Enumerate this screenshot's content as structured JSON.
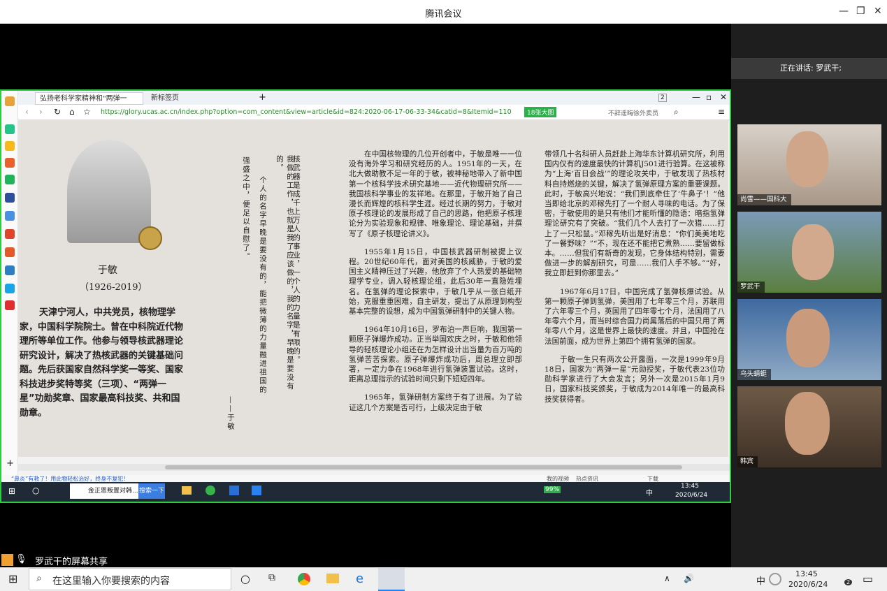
{
  "window": {
    "title": "腾讯会议"
  },
  "browser": {
    "tabs": [
      "弘扬老科学家精神和\"两弹一星\"精",
      "新标签页"
    ],
    "url": "https://glory.ucas.ac.cn/index.php?option=com_content&view=article&id=824:2020-06-17-06-33-34&catid=8&Itemid=110",
    "btn_bigimg": "18张大图",
    "search_placeholder": "不辞遥晦徐外卖员",
    "tab_count": "2",
    "status_left": "“鼻炎”有救了！用此物轻松治好，终身不复犯！",
    "status_right": [
      "我的视频",
      "热点资讯",
      "下载"
    ]
  },
  "article": {
    "name": "于敏",
    "years": "（1926-2019）",
    "bio": "天津宁河人，中共党员，核物理学家，中国科学院院士。曾在中科院近代物理所等单位工作。他参与领导核武器理论研究设计，解决了热核武器的关键基础问题。先后获国家自然科学奖一等奖、国家科技进步奖特等奖（三项）、“两弹一星”功勋奖章、国家最高科技奖、共和国勋章。",
    "quote_cols": [
      "核武器是成千上万人的事业，一个人的力量是有限的。",
      "我做的工作，也就是我了应该做的，我的名字，早晚是要没有的。",
      "个人的名字早晚是要没有的，能把微薄的力量融进祖国的",
      "强盛之中，便足以自慰了。"
    ],
    "quote_sig": "——于敏",
    "col1": [
      "在中国核物理的几位开创者中，于敏是唯一一位没有海外学习和研究经历的人。1951年的一天，在北大做助教不足一年的于敏，被神秘地带入了新中国第一个核科学技术研究基地——近代物理研究所——我国核科学事业的发祥地。在那里，于敏开始了自己漫长而辉煌的核科学生涯。经过长期的努力，于敏对原子核理论的发展形成了自己的思路，他把原子核理论分为实验现象和规律、唯象理论、理论基础，并撰写了《原子核理论讲义》。",
      "1955年1月15日，中国核武器研制被提上议程。20世纪60年代，面对美国的核威胁，于敏的爱国主义精神压过了兴趣，他放弃了个人热爱的基础物理学专业，调入轻核理论组，此后30年一直隐姓埋名。在氢弹的理论探索中，于敏几乎从一张白纸开始，克服重重困难，自主研发，提出了从原理到构型基本完整的设想，成为中国氢弹研制中的关键人物。",
      "1964年10月16日，罗布泊一声巨响，我国第一颗原子弹爆炸成功。正当举国欢庆之时，于敏和他领导的轻核理论小组还在为怎样设计出当量为百万吨的氢弹苦苦探索。原子弹爆炸成功后，周总理立即部署，一定力争在1968年进行氢弹装置试验。这时，距离总理指示的试验时间只剩下短短四年。",
      "1965年，氢弹研制方案终于有了进展。为了验证这几个方案是否可行，上级决定由于敏"
    ],
    "col2": [
      "带领几十名科研人员赶赴上海华东计算机研究所，利用国内仅有的速度最快的计算机J501进行验算。在这被称为“上海‘百日会战’”的理论攻关中，于敏发现了热核材料自持燃烧的关键，解决了氢弹原理方案的重要课题。此时，于敏高兴地说：“我们到底牵住了‘牛鼻子’！”他当即给北京的邓稼先打了一个耐人寻味的电话。为了保密，于敏使用的是只有他们才能听懂的隐语：暗指氢弹理论研究有了突破。“我们几个人去打了一次猎……打上了一只松鼠。”邓稼先听出是好消息：“你们美美地吃了一餐野味？”“不，现在还不能把它煮熟……要留做标本。……但我们有新奇的发现，它身体结构特别，需要做进一步的解剖研究，可是……我们人手不够。”“好，我立即赶到你那里去。”",
      "1967年6月17日，中国完成了氢弹核爆试验。从第一颗原子弹到氢弹，美国用了七年零三个月，苏联用了六年零三个月，英国用了四年零七个月，法国用了八年零六个月，而当时综合国力尚属落后的中国只用了两年零八个月，这是世界上最快的速度。并且，中国抢在法国前面，成为世界上第四个拥有氢弹的国家。",
      "于敏一生只有两次公开露面，一次是1999年9月18日，国家为“两弹一星”元勋授奖，于敏代表23位功勋科学家进行了大会发言；另外一次是2015年1月9日，国家科技奖颁奖，于敏成为2014年唯一的最高科技奖获得者。"
    ]
  },
  "inner_taskbar": {
    "ie_label": "金正恩叛置对韩...",
    "search_btn": "搜索一下",
    "battery": "99%",
    "ime": "中",
    "time": "13:45",
    "date": "2020/6/24"
  },
  "meeting": {
    "speaking_label": "正在讲话: 罗武干;",
    "participants": [
      "尚雪——国科大",
      "罗武干",
      "乌头蜻蜓",
      "韩宾"
    ],
    "share_label": "罗武干的屏幕共享"
  },
  "taskbar": {
    "search_placeholder": "在这里输入你要搜索的内容",
    "ime": "中",
    "time": "13:45",
    "date": "2020/6/24",
    "notif_count": "2"
  }
}
